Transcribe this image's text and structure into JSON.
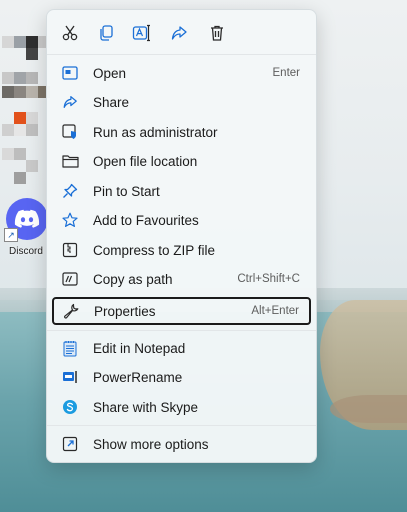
{
  "desktop": {
    "discord_label": "Discord",
    "shortcut_glyph": "↗"
  },
  "toolbar": {
    "items": [
      {
        "icon": "cut-icon"
      },
      {
        "icon": "copy-icon"
      },
      {
        "icon": "rename-icon"
      },
      {
        "icon": "share-icon"
      },
      {
        "icon": "delete-icon"
      }
    ]
  },
  "menu": {
    "items": [
      {
        "label": "Open",
        "shortcut": "Enter",
        "icon": "open-app-icon"
      },
      {
        "label": "Share",
        "shortcut": "",
        "icon": "share-icon"
      },
      {
        "label": "Run as administrator",
        "shortcut": "",
        "icon": "admin-shield-icon"
      },
      {
        "label": "Open file location",
        "shortcut": "",
        "icon": "folder-icon"
      },
      {
        "label": "Pin to Start",
        "shortcut": "",
        "icon": "pin-icon"
      },
      {
        "label": "Add to Favourites",
        "shortcut": "",
        "icon": "star-icon"
      },
      {
        "label": "Compress to ZIP file",
        "shortcut": "",
        "icon": "zip-icon"
      },
      {
        "label": "Copy as path",
        "shortcut": "Ctrl+Shift+C",
        "icon": "copy-path-icon"
      },
      {
        "label": "Properties",
        "shortcut": "Alt+Enter",
        "icon": "wrench-icon"
      },
      {
        "label": "Edit in Notepad",
        "shortcut": "",
        "icon": "notepad-icon"
      },
      {
        "label": "PowerRename",
        "shortcut": "",
        "icon": "powerrename-icon"
      },
      {
        "label": "Share with Skype",
        "shortcut": "",
        "icon": "skype-icon"
      },
      {
        "label": "Show more options",
        "shortcut": "",
        "icon": "more-options-icon"
      }
    ]
  },
  "colors": {
    "accent": "#1a6fd6",
    "discord": "#5865f2",
    "skype": "#1b9be0"
  }
}
